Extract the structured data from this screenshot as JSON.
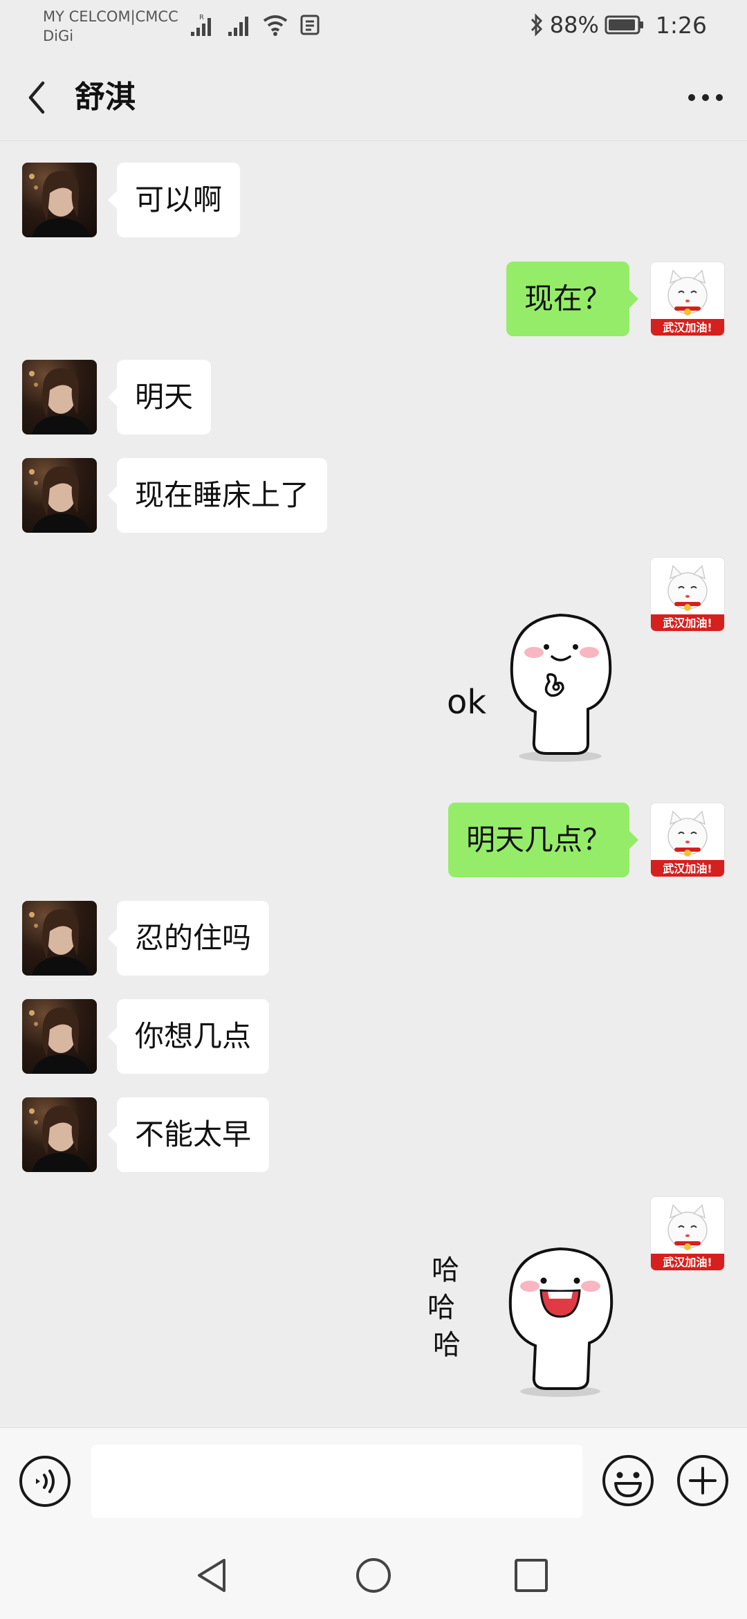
{
  "status_bar": {
    "carrier_line1": "MY CELCOM|CMCC",
    "carrier_line2": "DiGi",
    "roaming_marker": "R",
    "battery_percent": "88%",
    "time": "1:26",
    "icons": [
      "signal-icon",
      "signal-icon",
      "wifi-icon",
      "notification-icon",
      "bluetooth-icon",
      "battery-icon"
    ]
  },
  "header": {
    "title": "舒淇",
    "back_icon": "chevron-left-icon",
    "more_icon": "more-dots-icon"
  },
  "messages": [
    {
      "side": "left",
      "type": "text",
      "text": "可以啊"
    },
    {
      "side": "right",
      "type": "text",
      "text": "现在？"
    },
    {
      "side": "left",
      "type": "text",
      "text": "明天"
    },
    {
      "side": "left",
      "type": "text",
      "text": "现在睡床上了"
    },
    {
      "side": "right",
      "type": "sticker",
      "sticker_text": "ok"
    },
    {
      "side": "right",
      "type": "text",
      "text": "明天几点？"
    },
    {
      "side": "left",
      "type": "text",
      "text": "忍的住吗"
    },
    {
      "side": "left",
      "type": "text",
      "text": "你想几点"
    },
    {
      "side": "left",
      "type": "text",
      "text": "不能太早"
    },
    {
      "side": "right",
      "type": "sticker",
      "sticker_text": [
        "哈",
        "哈",
        "哈"
      ]
    }
  ],
  "self_avatar": {
    "banner_text": "武汉加油!"
  },
  "input_bar": {
    "placeholder": "",
    "value": "",
    "icons": [
      "voice-icon",
      "emoji-icon",
      "plus-icon"
    ]
  },
  "nav_bar": {
    "icons": [
      "nav-back-icon",
      "nav-home-icon",
      "nav-recents-icon"
    ]
  },
  "colors": {
    "background": "#ededed",
    "outgoing_bubble": "#95ec69",
    "incoming_bubble": "#ffffff",
    "cat_banner": "#d6201d"
  }
}
